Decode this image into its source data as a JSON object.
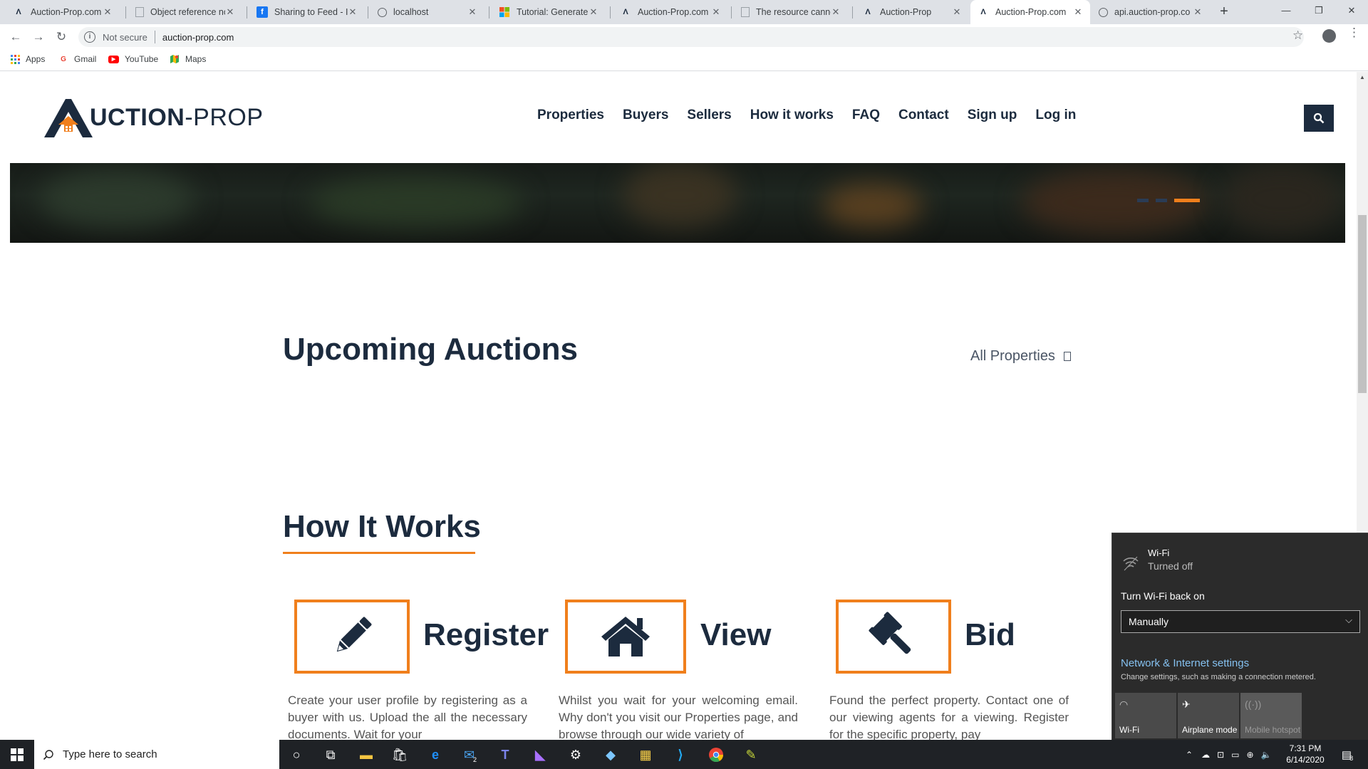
{
  "browser": {
    "tabs": [
      {
        "title": "Auction-Prop.com",
        "favicon": "auction-prop-icon",
        "active": false
      },
      {
        "title": "Object reference no",
        "favicon": "doc-icon",
        "active": false
      },
      {
        "title": "Sharing to Feed - In",
        "favicon": "facebook-icon",
        "active": false
      },
      {
        "title": "localhost",
        "favicon": "globe-icon",
        "active": false
      },
      {
        "title": "Tutorial: Generate v",
        "favicon": "microsoft-icon",
        "active": false
      },
      {
        "title": "Auction-Prop.com",
        "favicon": "auction-prop-icon",
        "active": false
      },
      {
        "title": "The resource canno",
        "favicon": "doc-icon",
        "active": false
      },
      {
        "title": "Auction-Prop",
        "favicon": "auction-prop-icon",
        "active": false
      },
      {
        "title": "Auction-Prop.com",
        "favicon": "auction-prop-icon",
        "active": true
      },
      {
        "title": "api.auction-prop.co",
        "favicon": "globe-icon",
        "active": false
      }
    ],
    "security_label": "Not secure",
    "url": "auction-prop.com",
    "bookmarks": [
      {
        "label": "Apps",
        "icon": "apps-grid-icon"
      },
      {
        "label": "Gmail",
        "icon": "google-icon"
      },
      {
        "label": "YouTube",
        "icon": "youtube-icon"
      },
      {
        "label": "Maps",
        "icon": "maps-icon"
      }
    ]
  },
  "site": {
    "logo_prefix": "UCTION",
    "logo_suffix": "-PROP",
    "nav": [
      "Properties",
      "Buyers",
      "Sellers",
      "How it works",
      "FAQ",
      "Contact",
      "Sign up",
      "Log in"
    ],
    "upcoming_title": "Upcoming Auctions",
    "all_properties": "All Properties",
    "how_title": "How It Works",
    "steps": [
      {
        "title": "Register",
        "icon": "pencil-icon",
        "text": "Create your user profile by registering as a buyer with us. Upload the all the necessary documents. Wait for your"
      },
      {
        "title": "View",
        "icon": "house-icon",
        "text": "Whilst you wait for your welcoming email. Why don't you visit our Properties page, and browse through our wide variety of"
      },
      {
        "title": "Bid",
        "icon": "gavel-icon",
        "text": "Found the perfect property. Contact one of our viewing agents for a viewing. Register for the specific property, pay"
      }
    ]
  },
  "wifi_flyout": {
    "title": "Wi-Fi",
    "status": "Turned off",
    "turn_back_on": "Turn Wi-Fi back on",
    "dropdown_value": "Manually",
    "settings_link": "Network & Internet settings",
    "settings_desc": "Change settings, such as making a connection metered.",
    "quick_actions": [
      {
        "label": "Wi-Fi",
        "icon": "wifi-icon",
        "enabled": true
      },
      {
        "label": "Airplane mode",
        "icon": "airplane-icon",
        "enabled": true
      },
      {
        "label": "Mobile hotspot",
        "icon": "hotspot-icon",
        "enabled": false
      }
    ]
  },
  "taskbar": {
    "search_placeholder": "Type here to search",
    "mail_badge": "2",
    "time": "7:31 PM",
    "date": "6/14/2020",
    "notif_badge": "8"
  },
  "colors": {
    "accent": "#f07f1c",
    "navy": "#1c2b3e"
  }
}
